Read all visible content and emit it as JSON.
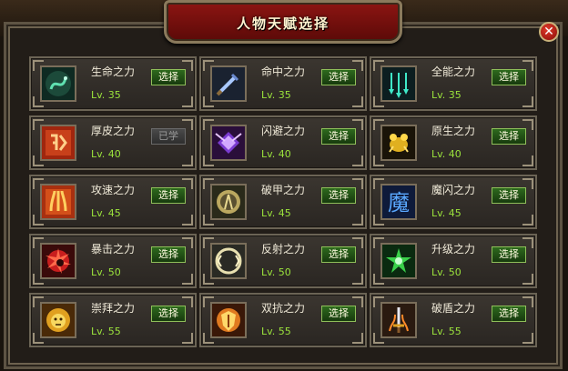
{
  "window": {
    "title": "人物天赋选择",
    "close_glyph": "✕"
  },
  "talents": [
    {
      "name": "生命之力",
      "level": "Lv. 35",
      "button": "选择",
      "state": "available",
      "icon": "green-serpent-icon"
    },
    {
      "name": "命中之力",
      "level": "Lv. 35",
      "button": "选择",
      "state": "available",
      "icon": "blue-sword-icon"
    },
    {
      "name": "全能之力",
      "level": "Lv. 35",
      "button": "选择",
      "state": "available",
      "icon": "triple-arrows-icon"
    },
    {
      "name": "厚皮之力",
      "level": "Lv. 40",
      "button": "已学",
      "state": "learned",
      "icon": "defense-rune-icon"
    },
    {
      "name": "闪避之力",
      "level": "Lv. 40",
      "button": "选择",
      "state": "available",
      "icon": "purple-wings-icon"
    },
    {
      "name": "原生之力",
      "level": "Lv. 40",
      "button": "选择",
      "state": "available",
      "icon": "golden-beast-icon"
    },
    {
      "name": "攻速之力",
      "level": "Lv. 45",
      "button": "选择",
      "state": "available",
      "icon": "fire-claw-icon"
    },
    {
      "name": "破甲之力",
      "level": "Lv. 45",
      "button": "选择",
      "state": "available",
      "icon": "armor-break-icon"
    },
    {
      "name": "魔闪之力",
      "level": "Lv. 45",
      "button": "选择",
      "state": "available",
      "icon": "magic-rune-icon"
    },
    {
      "name": "暴击之力",
      "level": "Lv. 50",
      "button": "选择",
      "state": "available",
      "icon": "crimson-burst-icon"
    },
    {
      "name": "反射之力",
      "level": "Lv. 50",
      "button": "选择",
      "state": "available",
      "icon": "reflect-shield-icon"
    },
    {
      "name": "升级之力",
      "level": "Lv. 50",
      "button": "选择",
      "state": "available",
      "icon": "green-star-icon"
    },
    {
      "name": "崇拜之力",
      "level": "Lv. 55",
      "button": "选择",
      "state": "available",
      "icon": "golden-lion-icon"
    },
    {
      "name": "双抗之力",
      "level": "Lv. 55",
      "button": "选择",
      "state": "available",
      "icon": "fire-shield-icon"
    },
    {
      "name": "破盾之力",
      "level": "Lv. 55",
      "button": "选择",
      "state": "available",
      "icon": "flaming-sword-icon"
    }
  ],
  "colors": {
    "level_text": "#9be33c",
    "select_button": "#2e6a1e",
    "learned_button": "#4a4a4a",
    "title_plate": "#8c1512"
  }
}
